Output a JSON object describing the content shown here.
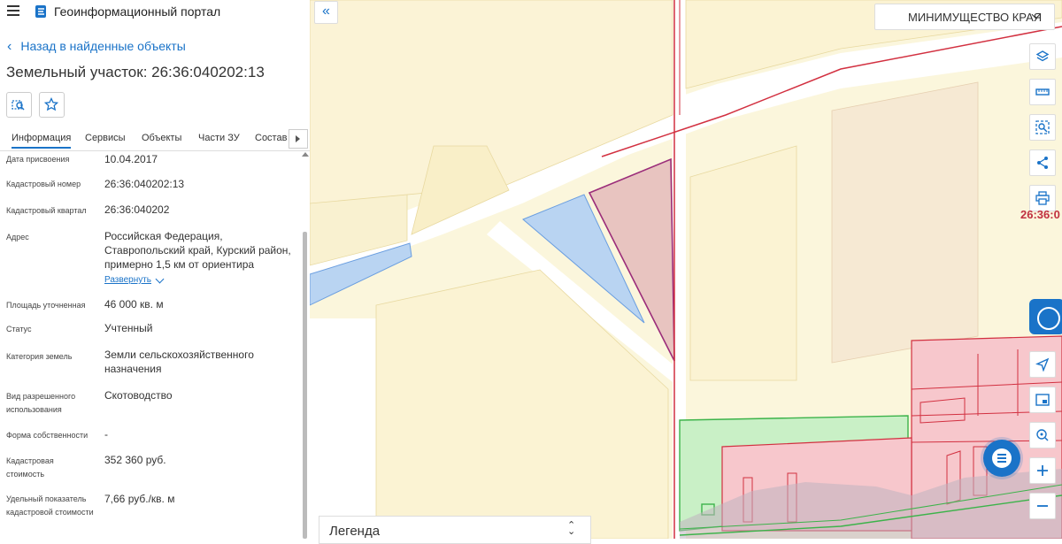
{
  "header": {
    "app_title": "Геоинформационный портал",
    "menu_icon": "hamburger-icon",
    "logo_icon": "portal-logo-icon"
  },
  "back_label": "Назад в найденные объекты",
  "parcel_title": "Земельный участок: 26:36:040202:13",
  "tabs": [
    {
      "label": "Информация",
      "active": true
    },
    {
      "label": "Сервисы"
    },
    {
      "label": "Объекты"
    },
    {
      "label": "Части ЗУ"
    },
    {
      "label": "Состав"
    }
  ],
  "properties": [
    {
      "label": "Дата присвоения",
      "value": "10.04.2017"
    },
    {
      "label": "Кадастровый номер",
      "value": "26:36:040202:13"
    },
    {
      "label": "Кадастровый квартал",
      "value": "26:36:040202"
    },
    {
      "label": "Адрес",
      "value": "Российская Федерация, Ставропольский край, Курский район, примерно 1,5 км от ориентира"
    },
    {
      "label": "Площадь уточненная",
      "value": "46 000 кв. м"
    },
    {
      "label": "Статус",
      "value": "Учтенный"
    },
    {
      "label": "Категория земель",
      "value": "Земли сельскохозяйственного назначения"
    },
    {
      "label": "Вид разрешенного использования",
      "value": "Скотоводство"
    },
    {
      "label": "Форма собственности",
      "value": "-"
    },
    {
      "label": "Кадастровая стоимость",
      "value": "352 360 руб."
    },
    {
      "label": "Удельный показатель кадастровой стоимости",
      "value": "7,66 руб./кв. м"
    }
  ],
  "expand_label": "Развернуть",
  "map": {
    "org_select": "МИНИМУЩЕСТВО КРАЯ",
    "parcel_label": "26:36:0",
    "legend_label": "Легенда",
    "tools": [
      "layers-icon",
      "ruler-icon",
      "area-search-icon",
      "share-icon",
      "print-icon"
    ],
    "nav_tools": [
      "locate-icon",
      "minimap-icon",
      "zoom-to-icon",
      "zoom-in-icon",
      "zoom-out-icon"
    ]
  },
  "colors": {
    "accent": "#1a73c8",
    "parcel_fill": "#e8c4c0",
    "parcel_border": "#9b2d7a",
    "boundary_red": "#d23040",
    "water": "#b9d4f2",
    "green_zone": "#c9f0c6"
  }
}
